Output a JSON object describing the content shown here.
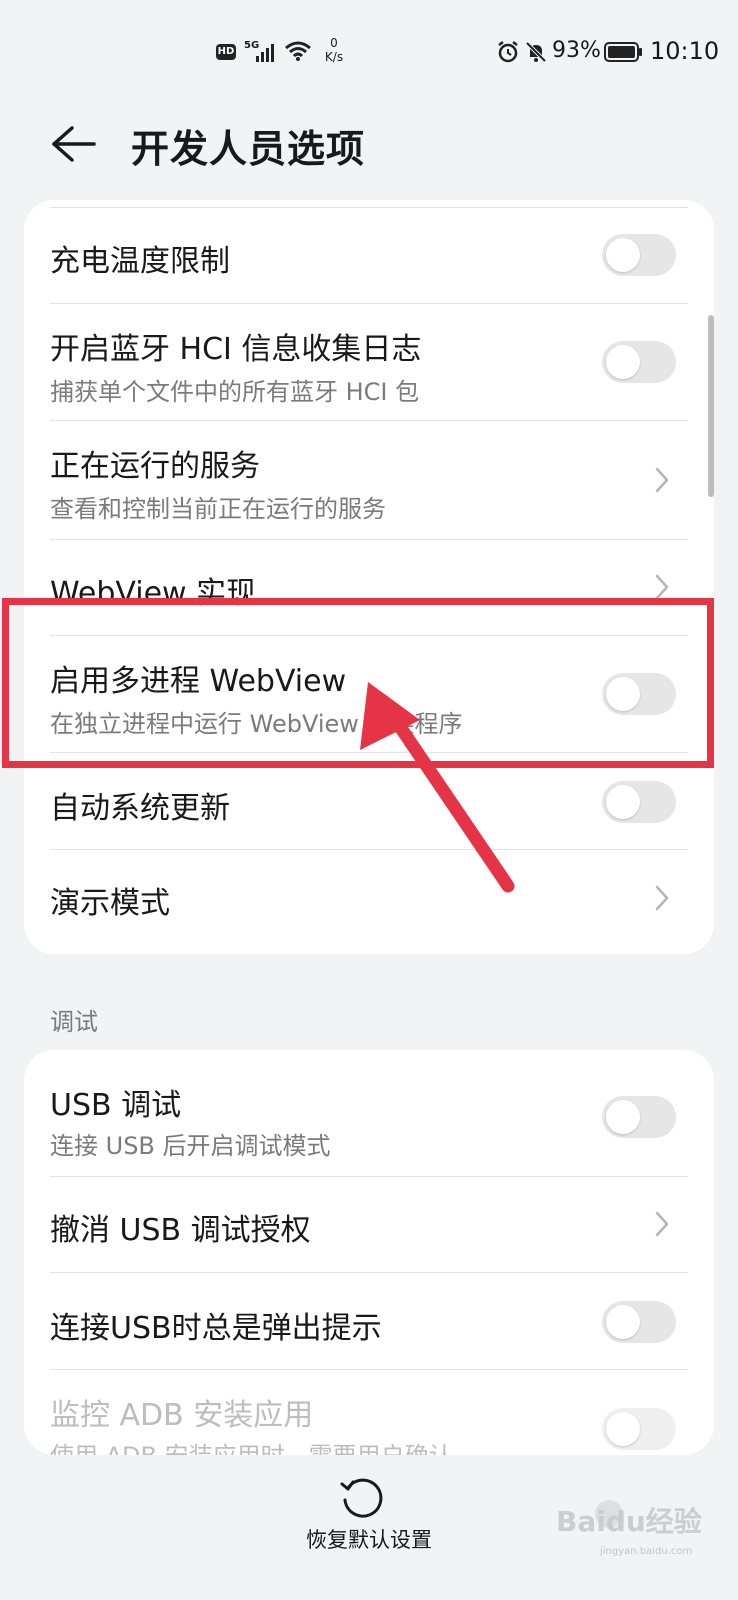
{
  "status_bar": {
    "hd": "HD",
    "network": "5G",
    "speed_value": "0",
    "speed_unit": "K/s",
    "battery": "93%",
    "time": "10:10"
  },
  "header": {
    "title": "开发人员选项"
  },
  "group1": {
    "items": [
      {
        "title": "充电温度限制",
        "control": "toggle",
        "on": false
      },
      {
        "title": "开启蓝牙 HCI 信息收集日志",
        "subtitle": "捕获单个文件中的所有蓝牙 HCI 包",
        "control": "toggle",
        "on": false
      },
      {
        "title": "正在运行的服务",
        "subtitle": "查看和控制当前正在运行的服务",
        "control": "chevron"
      },
      {
        "title": "WebView 实现",
        "control": "chevron"
      },
      {
        "title": "启用多进程 WebView",
        "subtitle": "在独立进程中运行 WebView 渲染程序",
        "control": "toggle",
        "on": false
      },
      {
        "title": "自动系统更新",
        "control": "toggle",
        "on": false
      },
      {
        "title": "演示模式",
        "control": "chevron"
      }
    ]
  },
  "section_debug": {
    "label": "调试"
  },
  "group2": {
    "items": [
      {
        "title": "USB 调试",
        "subtitle": "连接 USB 后开启调试模式",
        "control": "toggle",
        "on": false
      },
      {
        "title": "撤消 USB 调试授权",
        "control": "chevron"
      },
      {
        "title": "连接USB时总是弹出提示",
        "control": "toggle",
        "on": false
      },
      {
        "title": "监控 ADB 安装应用",
        "subtitle": "使用 ADB 安装应用时，需要用户确认",
        "control": "toggle",
        "on": false,
        "disabled": true
      }
    ]
  },
  "bottom": {
    "restore_label": "恢复默认设置"
  },
  "annotation": {
    "color": "#e53446"
  },
  "watermark": {
    "text": "Baidu经验",
    "domain": "jingyan.baidu.com"
  }
}
